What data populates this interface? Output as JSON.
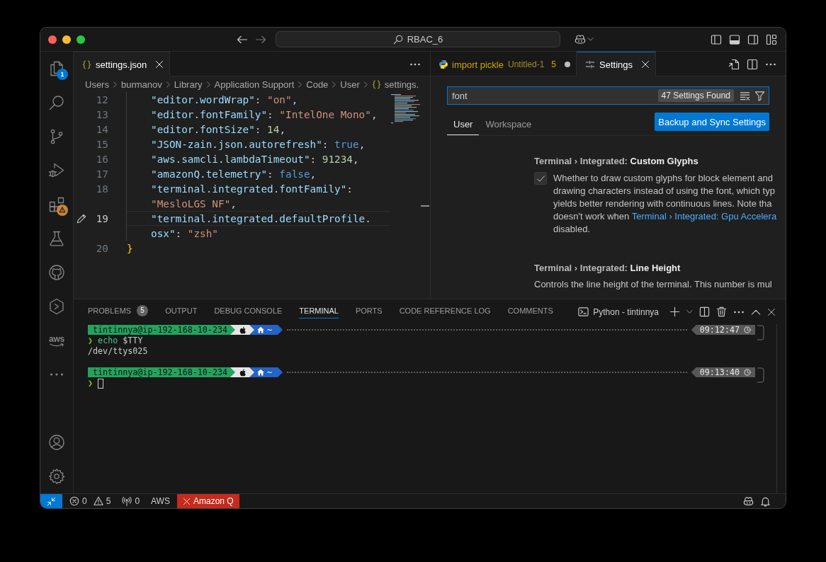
{
  "title_bar": {
    "command_center": "RBAC_6",
    "layout": {
      "primary_sidebar": false,
      "panel": true,
      "secondary_sidebar": false
    }
  },
  "activity_bar": {
    "items": [
      {
        "kind": "explorer",
        "badge": "1",
        "selected": false
      },
      {
        "kind": "search",
        "selected": false
      },
      {
        "kind": "source-control",
        "selected": false
      },
      {
        "kind": "debug",
        "selected": false
      },
      {
        "kind": "extensions",
        "warning": true,
        "selected": false
      },
      {
        "kind": "testing",
        "selected": false
      },
      {
        "kind": "github",
        "selected": false
      },
      {
        "kind": "hexagon",
        "selected": false
      },
      {
        "kind": "aws",
        "label": "aws",
        "selected": false
      },
      {
        "kind": "more",
        "selected": false
      }
    ],
    "bottom": [
      {
        "kind": "account"
      },
      {
        "kind": "manage"
      }
    ]
  },
  "editor_groups": [
    {
      "focused": false,
      "tabs": [
        {
          "kind": "json",
          "label": "settings.json",
          "selected": true,
          "dirty": false
        }
      ],
      "breadcrumb": [
        {
          "kind": "folder",
          "label": "Users"
        },
        {
          "kind": "folder",
          "label": "burmanov"
        },
        {
          "kind": "folder",
          "label": "Library"
        },
        {
          "kind": "folder",
          "label": "Application Support"
        },
        {
          "kind": "folder",
          "label": "Code"
        },
        {
          "kind": "folder",
          "label": "User"
        },
        {
          "kind": "json",
          "label": "settings."
        }
      ],
      "code": {
        "lines": [
          {
            "number": "12",
            "indented": true,
            "current": false,
            "edited": false,
            "rows": [
              {
                "tokens": [
                  {
                    "kind": "key",
                    "text": "\"editor.wordWrap\""
                  },
                  {
                    "kind": "punct",
                    "text": ": "
                  },
                  {
                    "kind": "string",
                    "text": "\"on\""
                  },
                  {
                    "kind": "punct",
                    "text": ","
                  }
                ]
              }
            ]
          },
          {
            "number": "13",
            "indented": true,
            "current": false,
            "edited": false,
            "rows": [
              {
                "tokens": [
                  {
                    "kind": "key",
                    "text": "\"editor.fontFamily\""
                  },
                  {
                    "kind": "punct",
                    "text": ": "
                  },
                  {
                    "kind": "string",
                    "text": "\"IntelOne Mono\""
                  },
                  {
                    "kind": "punct",
                    "text": ","
                  }
                ]
              }
            ]
          },
          {
            "number": "14",
            "indented": true,
            "current": false,
            "edited": false,
            "rows": [
              {
                "tokens": [
                  {
                    "kind": "key",
                    "text": "\"editor.fontSize\""
                  },
                  {
                    "kind": "punct",
                    "text": ": "
                  },
                  {
                    "kind": "number",
                    "text": "14"
                  },
                  {
                    "kind": "punct",
                    "text": ","
                  }
                ]
              }
            ]
          },
          {
            "number": "15",
            "indented": true,
            "current": false,
            "edited": false,
            "rows": [
              {
                "tokens": [
                  {
                    "kind": "key",
                    "text": "\"JSON-zain.json.autorefresh\""
                  },
                  {
                    "kind": "punct",
                    "text": ": "
                  },
                  {
                    "kind": "boolean",
                    "text": "true"
                  },
                  {
                    "kind": "punct",
                    "text": ","
                  }
                ]
              }
            ]
          },
          {
            "number": "16",
            "indented": true,
            "current": false,
            "edited": false,
            "rows": [
              {
                "tokens": [
                  {
                    "kind": "key",
                    "text": "\"aws.samcli.lambdaTimeout\""
                  },
                  {
                    "kind": "punct",
                    "text": ": "
                  },
                  {
                    "kind": "number",
                    "text": "91234"
                  },
                  {
                    "kind": "punct",
                    "text": ","
                  }
                ]
              }
            ]
          },
          {
            "number": "17",
            "indented": true,
            "current": false,
            "edited": false,
            "rows": [
              {
                "tokens": [
                  {
                    "kind": "key",
                    "text": "\"amazonQ.telemetry\""
                  },
                  {
                    "kind": "punct",
                    "text": ": "
                  },
                  {
                    "kind": "boolean",
                    "text": "false"
                  },
                  {
                    "kind": "punct",
                    "text": ","
                  }
                ]
              }
            ]
          },
          {
            "number": "18",
            "indented": true,
            "current": false,
            "edited": false,
            "rows": [
              {
                "tokens": [
                  {
                    "kind": "key",
                    "text": "\"terminal.integrated.fontFamily\""
                  },
                  {
                    "kind": "punct",
                    "text": ":"
                  }
                ]
              },
              {
                "tokens": [
                  {
                    "kind": "string",
                    "text": "\"MesloLGS NF\""
                  },
                  {
                    "kind": "punct",
                    "text": ","
                  }
                ]
              }
            ]
          },
          {
            "number": "19",
            "indented": true,
            "current": true,
            "edited": true,
            "rows": [
              {
                "tokens": [
                  {
                    "kind": "key",
                    "text": "\"terminal.integrated.defaultProfile."
                  }
                ]
              },
              {
                "tokens": [
                  {
                    "kind": "key",
                    "text": "osx\""
                  },
                  {
                    "kind": "punct",
                    "text": ": "
                  },
                  {
                    "kind": "string",
                    "text": "\"zsh\""
                  }
                ]
              }
            ]
          },
          {
            "number": "20",
            "indented": false,
            "current": false,
            "edited": false,
            "rows": [
              {
                "tokens": [
                  {
                    "kind": "bracket",
                    "text": "}"
                  }
                ]
              }
            ]
          }
        ]
      }
    },
    {
      "focused": true,
      "tabs": [
        {
          "kind": "python",
          "label": "import pickle",
          "description": "Untitled-1",
          "problems": "5",
          "selected": false,
          "dirty": true
        },
        {
          "kind": "settings",
          "label": "Settings",
          "selected": true,
          "dirty": false
        }
      ],
      "settings": {
        "search": {
          "value": "font",
          "result_count": "47 Settings Found"
        },
        "scopes": [
          {
            "label": "User",
            "selected": true
          },
          {
            "label": "Workspace",
            "selected": false
          }
        ],
        "sync_button": "Backup and Sync Settings",
        "items": [
          {
            "kind": "checkbox",
            "title": "Terminal › Integrated: **Custom Glyphs**",
            "checked": true,
            "description": [
              {
                "segments": [
                  {
                    "kind": "text",
                    "text": "Whether to draw custom glyphs for block element and"
                  }
                ]
              },
              {
                "segments": [
                  {
                    "kind": "text",
                    "text": "drawing characters instead of using the font, which typ"
                  }
                ]
              },
              {
                "segments": [
                  {
                    "kind": "text",
                    "text": "yields better rendering with continuous lines. Note tha"
                  }
                ]
              },
              {
                "segments": [
                  {
                    "kind": "text",
                    "text": "doesn't work when "
                  },
                  {
                    "kind": "link",
                    "text": "Terminal › Integrated: Gpu Accelera"
                  }
                ]
              },
              {
                "segments": [
                  {
                    "kind": "text",
                    "text": "disabled."
                  }
                ]
              }
            ]
          },
          {
            "kind": "number",
            "title": "Terminal › Integrated: **Line Height**",
            "description": [
              {
                "segments": [
                  {
                    "kind": "text",
                    "text": "Controls the line height of the terminal. This number is mul"
                  }
                ]
              }
            ]
          }
        ]
      }
    }
  ],
  "panel": {
    "tabs": [
      {
        "label": "PROBLEMS",
        "badge": "5",
        "selected": false
      },
      {
        "label": "OUTPUT",
        "selected": false
      },
      {
        "label": "DEBUG CONSOLE",
        "selected": false
      },
      {
        "label": "TERMINAL",
        "selected": true
      },
      {
        "label": "PORTS",
        "selected": false
      },
      {
        "label": "CODE REFERENCE LOG",
        "selected": false
      },
      {
        "label": "COMMENTS",
        "selected": false
      }
    ],
    "terminal_name": "Python - tintinnya",
    "terminal": [
      {
        "kind": "prompt",
        "user": "tintinnya@ip-192-168-10-234",
        "directory": "~",
        "time": "09:12:47"
      },
      {
        "kind": "command",
        "prompt": "❯",
        "command": "echo",
        "args": "$TTY"
      },
      {
        "kind": "output",
        "text": "/dev/ttys025"
      },
      {
        "kind": "blank"
      },
      {
        "kind": "prompt",
        "user": "tintinnya@ip-192-168-10-234",
        "directory": "~",
        "time": "09:13:40"
      },
      {
        "kind": "input",
        "prompt": "❯"
      }
    ]
  },
  "status_bar": {
    "left": [
      {
        "kind": "remote"
      },
      {
        "kind": "problems",
        "errors": "0",
        "warnings": "5"
      },
      {
        "kind": "ports",
        "count": "0"
      },
      {
        "kind": "text",
        "label": "AWS"
      },
      {
        "kind": "error",
        "label": "Amazon Q"
      }
    ],
    "right": [
      {
        "kind": "copilot"
      },
      {
        "kind": "notifications"
      }
    ]
  }
}
